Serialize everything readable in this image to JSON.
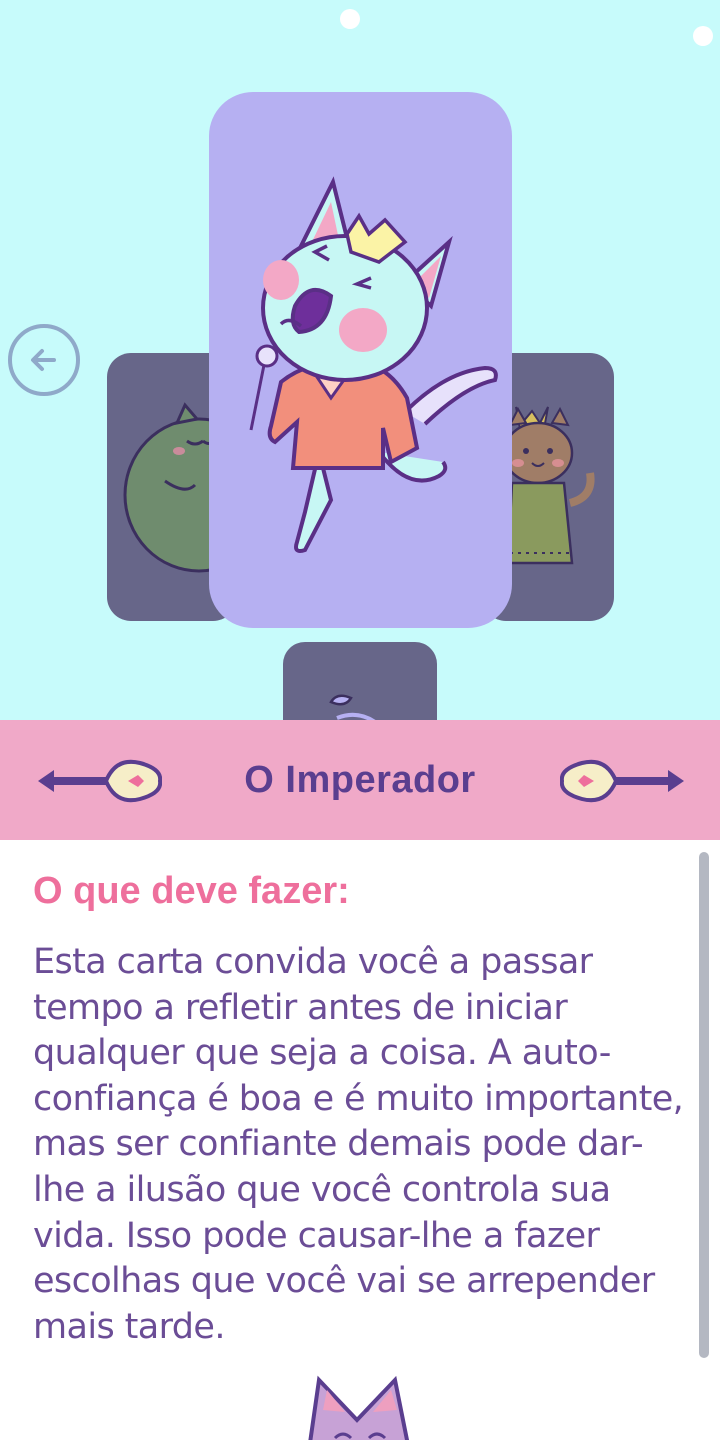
{
  "card_title": "O Imperador",
  "section": {
    "heading": "O que deve fazer:",
    "body": "Esta carta convida você a passar tempo a refletir antes de iniciar qualquer que seja a coisa. A auto-confiança é boa e é muito importante, mas ser confiante demais pode dar-lhe a ilusão que você controla sua vida. Isso pode causar-lhe a fazer escolhas que você vai se arrepender mais tarde."
  },
  "icons": {
    "back": "arrow-left-circle-icon",
    "prev": "arrow-left-heart-icon",
    "next": "arrow-right-heart-icon"
  },
  "colors": {
    "background": "#c7fbfb",
    "title_bar": "#f0a9c8",
    "title_text": "#5a3e8f",
    "heading": "#ee6f9c",
    "body_text": "#6b4d96",
    "card_main": "#b6b0f2",
    "card_side": "#676689"
  }
}
